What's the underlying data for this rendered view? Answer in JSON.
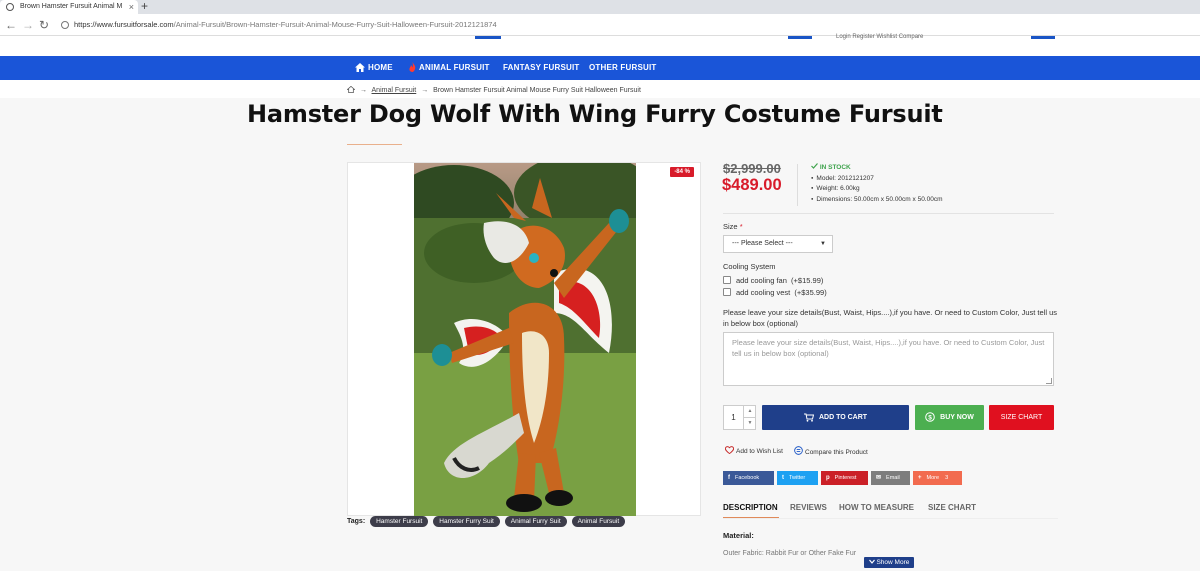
{
  "browser": {
    "tab_title": "Brown Hamster Fursuit Animal M",
    "tab_close": "×",
    "new_tab": "+",
    "url_domain": "https://www.fursuitforsale.com",
    "url_path": "/Animal-Fursuit/Brown-Hamster-Fursuit-Animal-Mouse-Furry-Suit-Halloween-Fursuit-2012121874",
    "back": "←",
    "forward": "→",
    "reload": "↻"
  },
  "header": {
    "top_links": "Login   Register   Wishlist   Compare"
  },
  "nav": {
    "items": [
      {
        "label": "HOME",
        "icon": "home-icon"
      },
      {
        "label": "ANIMAL FURSUIT",
        "icon": "flame-icon"
      },
      {
        "label": "FANTASY FURSUIT"
      },
      {
        "label": "OTHER FURSUIT"
      }
    ]
  },
  "breadcrumb": {
    "home_icon": "home-icon",
    "sep": "→",
    "items": [
      "Animal Fursuit",
      "Brown Hamster Fursuit Animal Mouse Furry Suit Halloween Fursuit"
    ]
  },
  "product": {
    "title": "Hamster Dog Wolf With Wing Furry Costume Fursuit",
    "discount": "-84 %",
    "old_price": "$2,999.00",
    "price": "$489.00",
    "stock": "IN STOCK",
    "specs": [
      "Model: 2012121207",
      "Weight: 6.00kg",
      "Dimensions: 50.00cm x 50.00cm x 50.00cm"
    ],
    "size_label": "Size",
    "size_required": "*",
    "size_select": "--- Please Select ---",
    "cooling_label": "Cooling System",
    "cooling_options": [
      {
        "label": "add cooling fan",
        "price": "(+$15.99)"
      },
      {
        "label": "add cooling vest",
        "price": "(+$35.99)"
      }
    ],
    "details_label": "Please leave your size details(Bust, Waist, Hips....),if you have. Or need to Custom Color, Just tell us in below box (optional)",
    "details_placeholder": "Please leave your size details(Bust, Waist, Hips....),if you have. Or need to Custom Color, Just tell us in below box (optional)",
    "quantity": "1",
    "add_to_cart": "ADD TO CART",
    "buy_now": "BUY NOW",
    "size_chart": "SIZE CHART",
    "wishlist": "Add to Wish List",
    "compare": "Compare this Product",
    "tags_label": "Tags:",
    "tags": [
      "Hamster Fursuit",
      "Hamster Furry Suit",
      "Animal Furry Suit",
      "Animal Fursuit"
    ]
  },
  "share": [
    {
      "label": "Facebook",
      "icon": "f",
      "color": "#3b5998"
    },
    {
      "label": "Twitter",
      "icon": "t",
      "color": "#1da1f2"
    },
    {
      "label": "Pinterest",
      "icon": "p",
      "color": "#cb2027"
    },
    {
      "label": "Email",
      "icon": "✉",
      "color": "#7d7d7d"
    },
    {
      "label": "More",
      "icon": "+",
      "count": "3",
      "color": "#f26b4f"
    }
  ],
  "product_tabs": [
    "DESCRIPTION",
    "REVIEWS",
    "HOW TO MEASURE",
    "SIZE CHART"
  ],
  "description": {
    "material_heading": "Material:",
    "outer_fabric": "Outer Fabric: Rabbit Fur or Other Fake Fur",
    "show_more": "Show More"
  },
  "colors": {
    "nav_blue": "#1a55d8",
    "price_red": "#d81b2a",
    "cart_blue": "#1f3f8a",
    "buy_green": "#4caf50",
    "chart_red": "#e0101f",
    "stock_green": "#3fa34d"
  }
}
